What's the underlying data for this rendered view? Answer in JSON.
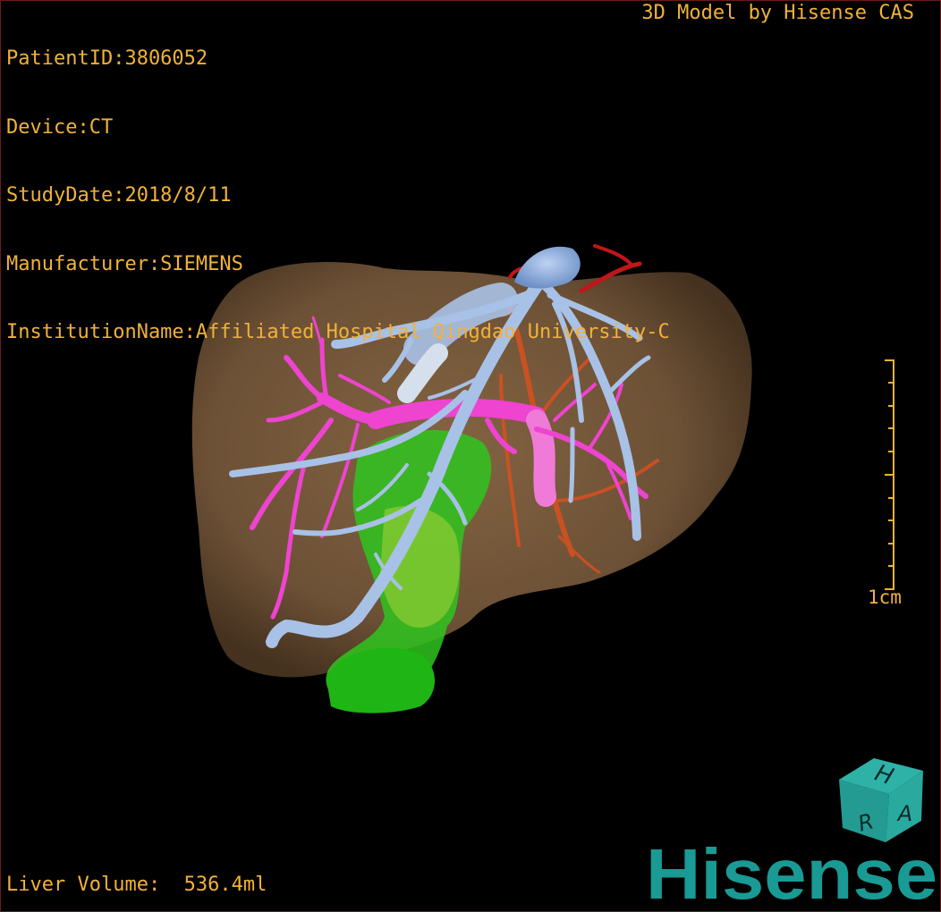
{
  "viewer": {
    "patient_id": "PatientID:3806052",
    "device": "Device:CT",
    "study_date": "StudyDate:2018/8/11",
    "manufacturer": "Manufacturer:SIEMENS",
    "institution": "InstitutionName:Affiliated Hospital Qingdao University-C",
    "credit": "3D Model by Hisense CAS",
    "liver_volume": "Liver Volume:  536.4ml",
    "scale_label": "1cm"
  },
  "orientation_cube": {
    "top": "H",
    "left": "R",
    "right": "A"
  },
  "brand": "Hisense",
  "colors": {
    "overlay_text": "#f0b238",
    "liver": "#7a5c3e",
    "hepatic_vein": "#a8c1e6",
    "portal_vein": "#ee44d0",
    "hepatic_artery": "#d8501e",
    "lesion": "#2fc41f",
    "brand": "#1a9a94"
  }
}
